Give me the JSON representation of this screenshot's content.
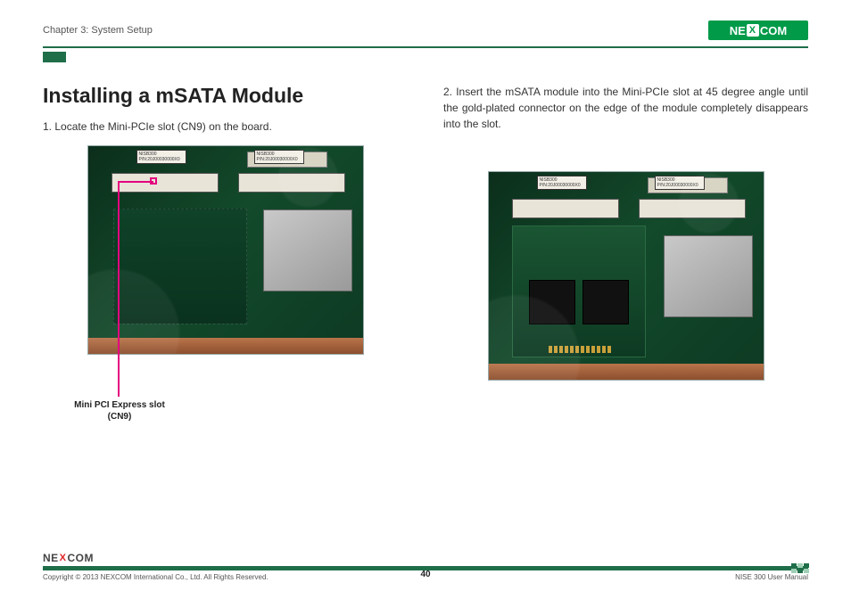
{
  "header": {
    "chapter": "Chapter 3: System Setup",
    "logo_text": {
      "part1": "NE",
      "x": "X",
      "part2": "COM"
    }
  },
  "title": "Installing a mSATA Module",
  "steps": {
    "step1": "1. Locate the Mini-PCIe slot (CN9) on the board.",
    "step2": "2. Insert the mSATA module into the Mini-PCIe slot at 45 degree angle until the gold-plated connector on the edge of the module completely disappears into the slot."
  },
  "callout": {
    "line1": "Mini PCI Express slot",
    "line2": "(CN9)"
  },
  "board_labels": {
    "sticker": "NISB300\nP/N:20J00030000X0"
  },
  "footer": {
    "logo": {
      "part1": "NE",
      "x": "X",
      "part2": "COM"
    },
    "copyright": "Copyright © 2013 NEXCOM International Co., Ltd. All Rights Reserved.",
    "page": "40",
    "doc": "NISE 300 User Manual"
  }
}
